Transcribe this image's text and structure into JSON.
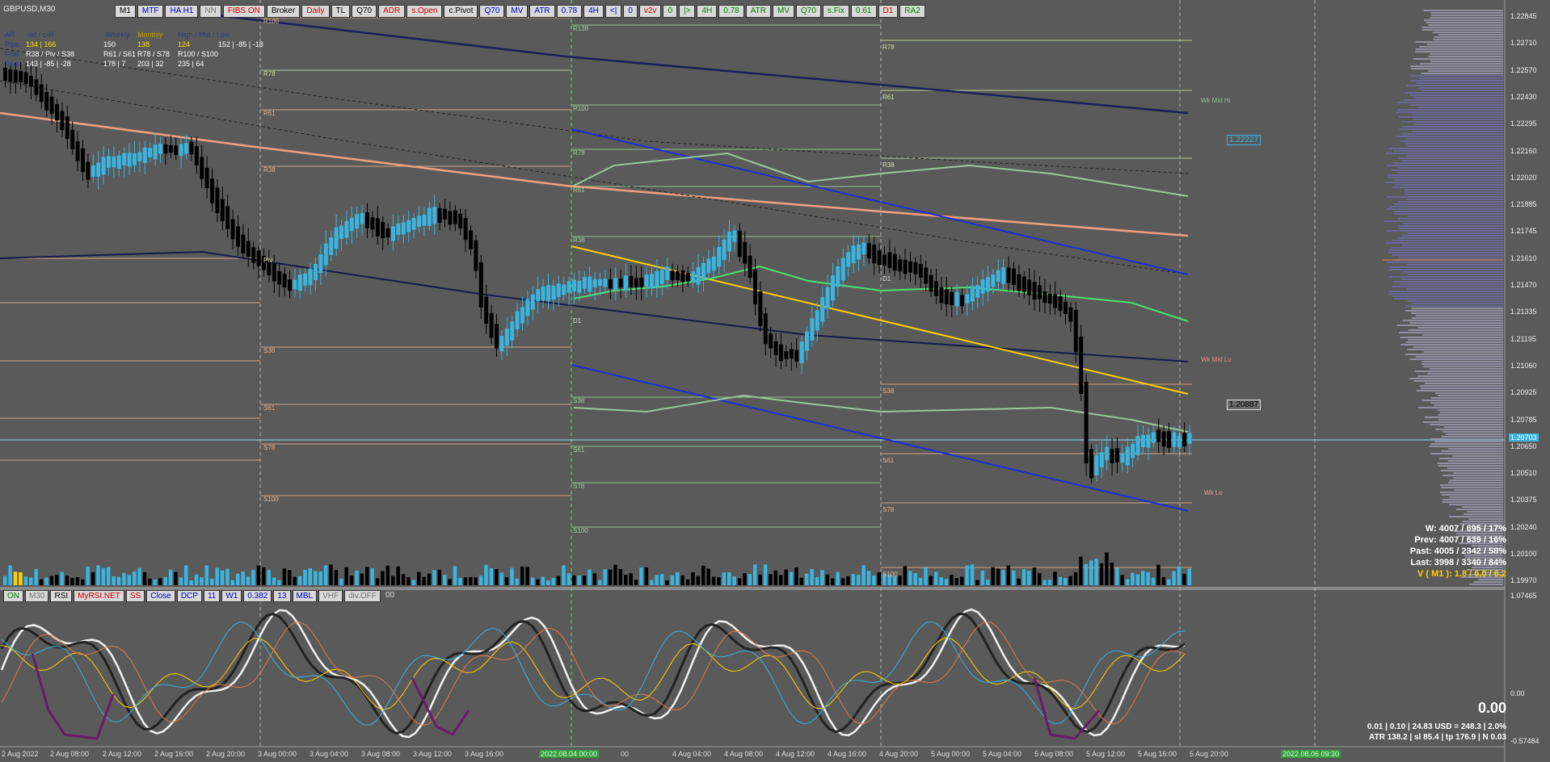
{
  "symbol": "GBPUSD,M30",
  "toolbar": [
    "M1",
    "MTF",
    "HA H1",
    "NN",
    "FIBS ON",
    "Broker",
    "Daily",
    "TL",
    "Q70",
    "ADR",
    "s.Open",
    "c.Pivot",
    "Q70",
    "MV",
    "ATR",
    "0.78",
    "4H",
    "<|",
    "0",
    "v2v",
    "0",
    "|>",
    "4H",
    "0.78",
    "ATR",
    "MV",
    "Q70",
    "s.Fix",
    "0.61",
    "D1",
    "RA2"
  ],
  "toolbar_colors": [
    "#000",
    "#0000c0",
    "#0000c0",
    "#777",
    "#d00000",
    "#000",
    "#d00000",
    "#000",
    "#000",
    "#d00000",
    "#d00000",
    "#000",
    "#0000c0",
    "#0000c0",
    "#0000c0",
    "#0000c0",
    "#0000c0",
    "#0000c0",
    "#0000c0",
    "#d00000",
    "#008000",
    "#008000",
    "#008000",
    "#008000",
    "#008000",
    "#008000",
    "#008000",
    "#008000",
    "#008000",
    "#d00000",
    "#008000"
  ],
  "subtoolbar": [
    "ON",
    "M30",
    "RSI",
    "MyRSI.NET",
    "SS",
    "Close",
    "DCP",
    "11",
    "W1",
    "0.382",
    "13",
    "MBL",
    "VHF",
    "div.OFF",
    "00"
  ],
  "subtoolbar_colors": [
    "#008000",
    "#777",
    "#000",
    "#d00000",
    "#d00000",
    "#0000c0",
    "#0000c0",
    "#0000c0",
    "#0000c0",
    "#0000c0",
    "#0000c0",
    "#0000c0",
    "#777",
    "#777",
    "#ddd"
  ],
  "info_rows": [
    {
      "cells": [
        "AR",
        "-9d / c-R",
        "-Weekly",
        "Monthly",
        "High / Mid / Low"
      ],
      "colors": [
        "#2a3a8a",
        "#2a3a8a",
        "#2a3a8a",
        "#c5a000",
        "#2a3a8a"
      ]
    },
    {
      "cells": [
        "Pips",
        "134 | 166",
        "150",
        "138",
        "124",
        "152 | -85 | -18"
      ],
      "colors": [
        "#2a3a8a",
        "#ffe000",
        "#fff",
        "#ffe000",
        "#ffe000",
        "#fff"
      ]
    },
    {
      "cells": [
        "Fibo",
        "R38 / Piv / S38",
        "R61 / S61",
        "R78 / S78",
        "R100 / S100"
      ],
      "colors": [
        "#2a3a8a",
        "#fff",
        "#fff",
        "#fff",
        "#fff"
      ]
    },
    {
      "cells": [
        "Pips",
        "143 | -85 | -28",
        "178 | 7",
        "203 | 32",
        "235 | 64"
      ],
      "colors": [
        "#2a3a8a",
        "#fff",
        "#fff",
        "#fff",
        "#fff"
      ]
    }
  ],
  "price_axis": [
    "1.22845",
    "1.22710",
    "1.22570",
    "1.22430",
    "1.22295",
    "1.22160",
    "1.22020",
    "1.21885",
    "1.21745",
    "1.21610",
    "1.21470",
    "1.21335",
    "1.21195",
    "1.21060",
    "1.20925",
    "1.20785",
    "1.20650",
    "1.20510",
    "1.20375",
    "1.20240",
    "1.20100",
    "1.19970"
  ],
  "current_price": "1.20703",
  "price_labels": [
    {
      "text": "1.22227",
      "color": "#39b5e0"
    },
    {
      "text": "1.20887",
      "color": "#222"
    }
  ],
  "osc_axis": [
    "1.07465",
    "0.00",
    "-0.57484"
  ],
  "time_axis": [
    "2 Aug 2022",
    "2 Aug 08:00",
    "2 Aug 12:00",
    "2 Aug 16:00",
    "2 Aug 20:00",
    "3 Aug 00:00",
    "3 Aug 04:00",
    "3 Aug 08:00",
    "3 Aug 12:00",
    "3 Aug 16:00",
    "2022.08.04 00:00",
    "00",
    "4 Aug 04:00",
    "4 Aug 08:00",
    "4 Aug 12:00",
    "4 Aug 16:00",
    "4 Aug 20:00",
    "5 Aug 00:00",
    "5 Aug 04:00",
    "5 Aug 08:00",
    "5 Aug 12:00",
    "5 Aug 16:00",
    "5 Aug 20:00",
    "2022.08.06 09:30"
  ],
  "level_labels": [
    "R100",
    "R78",
    "R61",
    "R38",
    "Piv",
    "S38",
    "S61",
    "S78",
    "S100",
    "R138",
    "R100",
    "R78",
    "R61",
    "R38",
    "D1",
    "S38",
    "S61",
    "S78",
    "S100",
    "R78",
    "R61",
    "R38",
    "D1",
    "S38",
    "S61",
    "S78",
    "S100",
    "Wk Mid Hi",
    "Wk Mid Lo",
    "Wk Lo"
  ],
  "stats": {
    "w": "W: 4007 / 695 / 17%",
    "prev": "Prev: 4007 / 639 / 16%",
    "past": "Past: 4005 / 2342 / 58%",
    "last": "Last: 3998 / 3340 / 84%",
    "v": "V ( M1 ): 1.8 / 6.0 / 6.2"
  },
  "osc_value": "0.00",
  "footer": {
    "line1": "0.01  |  0.10  |  24.83 USD = 248.3  |  2.0%",
    "line2": "ATR 138.2  |  sl 85.4  |  tp 176.9  |  N 0.03"
  },
  "colors": {
    "background": "#5a5a5a",
    "bull": "#39b5e0",
    "bear": "#000000",
    "accent_yellow": "#ffd000",
    "channel": "#1a2fd0"
  }
}
